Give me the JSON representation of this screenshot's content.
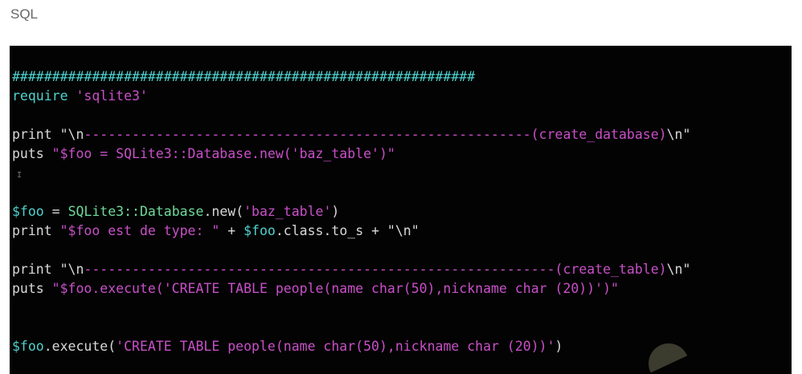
{
  "section_title": "SQL",
  "colors": {
    "cyan": "#4fd3cf",
    "magenta": "#c850c8",
    "plain": "#d8d8d8",
    "green": "#6fd89a"
  },
  "code_lines": [
    [
      {
        "t": "##########################################################",
        "c": "cyan"
      }
    ],
    [
      {
        "t": "require ",
        "c": "cyan"
      },
      {
        "t": "'sqlite3'",
        "c": "magenta"
      }
    ],
    [],
    [
      {
        "t": "print ",
        "c": "plain"
      },
      {
        "t": "\"",
        "c": "plain"
      },
      {
        "t": "\\n",
        "c": "plain"
      },
      {
        "t": "--------------------------------------------------------(create_database)",
        "c": "magenta"
      },
      {
        "t": "\\n\"",
        "c": "plain"
      }
    ],
    [
      {
        "t": "puts ",
        "c": "plain"
      },
      {
        "t": "\"$foo = SQLite3::Database.new('baz_table')\"",
        "c": "magenta"
      }
    ],
    [
      {
        "t": "I",
        "c": "cursor"
      }
    ],
    [],
    [
      {
        "t": "$foo",
        "c": "cyan"
      },
      {
        "t": " = ",
        "c": "plain"
      },
      {
        "t": "SQLite3::Database",
        "c": "green"
      },
      {
        "t": ".new(",
        "c": "plain"
      },
      {
        "t": "'baz_table'",
        "c": "magenta"
      },
      {
        "t": ")",
        "c": "plain"
      }
    ],
    [
      {
        "t": "print ",
        "c": "plain"
      },
      {
        "t": "\"$foo est de type: \"",
        "c": "magenta"
      },
      {
        "t": " + ",
        "c": "plain"
      },
      {
        "t": "$foo",
        "c": "cyan"
      },
      {
        "t": ".class.to_s + \"\\n\"",
        "c": "plain"
      }
    ],
    [],
    [
      {
        "t": "print ",
        "c": "plain"
      },
      {
        "t": "\"",
        "c": "plain"
      },
      {
        "t": "\\n",
        "c": "plain"
      },
      {
        "t": "-----------------------------------------------------------(create_table)",
        "c": "magenta"
      },
      {
        "t": "\\n\"",
        "c": "plain"
      }
    ],
    [
      {
        "t": "puts ",
        "c": "plain"
      },
      {
        "t": "\"$foo.execute('CREATE TABLE people(name char(50),nickname char (20))')\"",
        "c": "magenta"
      }
    ],
    [],
    [],
    [
      {
        "t": "$foo",
        "c": "cyan"
      },
      {
        "t": ".execute(",
        "c": "plain"
      },
      {
        "t": "'CREATE TABLE people(name char(50),nickname char (20))'",
        "c": "magenta"
      },
      {
        "t": ")",
        "c": "plain"
      }
    ]
  ]
}
